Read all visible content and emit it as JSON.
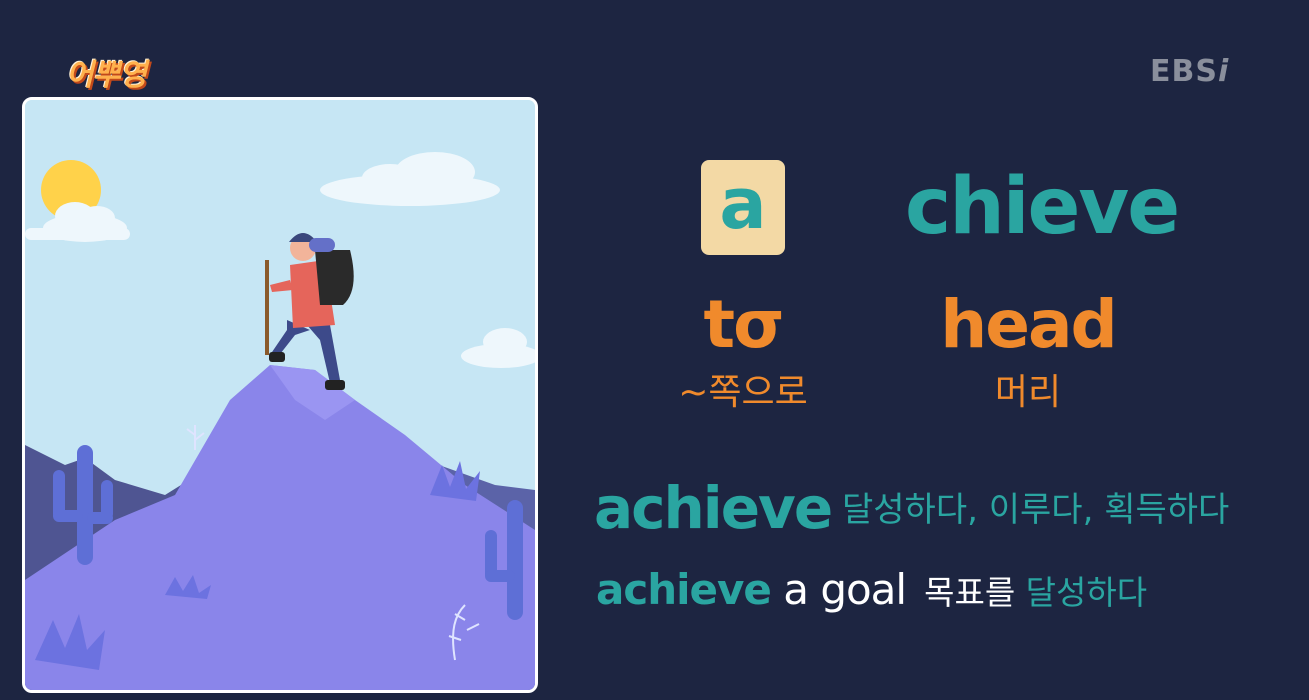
{
  "branding": {
    "show_logo": "어뿌영",
    "channel_logo_main": "EBS",
    "channel_logo_suffix": "i"
  },
  "etymology": {
    "prefix": "a",
    "root": "chieve",
    "prefix_meaning_en": "tσ",
    "prefix_meaning_ko": "~쪽으로",
    "root_meaning_en": "head",
    "root_meaning_ko": "머리"
  },
  "vocabulary": {
    "word": "achieve",
    "definition": "달성하다, 이루다, 획득하다"
  },
  "example": {
    "word": "achieve",
    "rest": " a goal",
    "ko_plain": "목표를 ",
    "ko_highlight": "달성하다"
  },
  "colors": {
    "background": "#1d2541",
    "teal": "#2aa5a1",
    "orange": "#f08a2c",
    "prefix_box": "#f3d9a5"
  },
  "illustration": {
    "subject": "hiker-on-mountain-icon"
  }
}
